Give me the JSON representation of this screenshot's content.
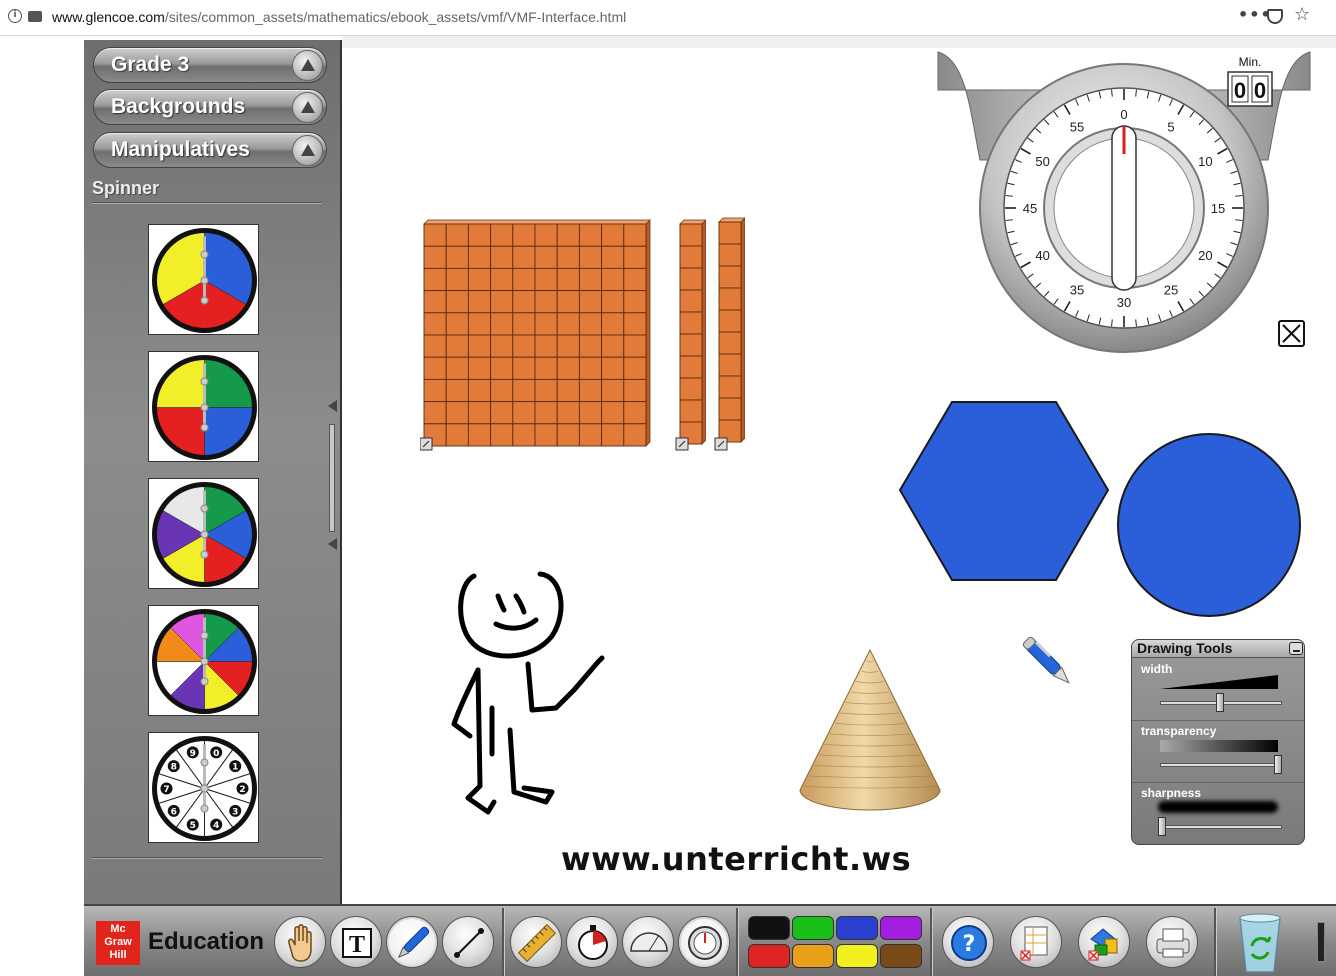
{
  "browser": {
    "url_domain": "www.glencoe.com",
    "url_path": "/sites/common_assets/mathematics/ebook_assets/vmf/VMF-Interface.html",
    "more_label": "•••"
  },
  "sidebar": {
    "menus": [
      {
        "label": "Grade 3"
      },
      {
        "label": "Backgrounds"
      },
      {
        "label": "Manipulatives"
      }
    ],
    "section_title": "Spinner",
    "spinners": [
      {
        "name": "3-color",
        "colors": [
          "#2b5fd9",
          "#e52020",
          "#f2ee2a"
        ]
      },
      {
        "name": "4-color",
        "colors": [
          "#149a4a",
          "#2b5fd9",
          "#e52020",
          "#f2ee2a"
        ]
      },
      {
        "name": "6-color",
        "colors": [
          "#149a4a",
          "#2b5fd9",
          "#e52020",
          "#f2ee2a",
          "#6a35b5",
          "#e8e8e8"
        ]
      },
      {
        "name": "8-color",
        "colors": [
          "#149a4a",
          "#2b5fd9",
          "#e52020",
          "#f2ee2a",
          "#6a35b5",
          "#ffffff",
          "#f28a1a",
          "#e055e0"
        ]
      },
      {
        "name": "numbers",
        "numbers": [
          "0",
          "1",
          "2",
          "3",
          "4",
          "5",
          "6",
          "7",
          "8",
          "9"
        ]
      }
    ]
  },
  "timer": {
    "min_label": "Min.",
    "digits": [
      "0",
      "0"
    ],
    "dial_numbers": [
      "0",
      "5",
      "10",
      "15",
      "20",
      "25",
      "30",
      "35",
      "40",
      "45",
      "50",
      "55"
    ]
  },
  "watermark": "www.unterricht.ws",
  "drawing_tools": {
    "title": "Drawing Tools",
    "rows": [
      {
        "label": "width",
        "knob": 0.5
      },
      {
        "label": "transparency",
        "knob": 1.0
      },
      {
        "label": "sharpness",
        "knob": 0.0
      }
    ]
  },
  "toolbar": {
    "logo_lines": [
      "Mc",
      "Graw",
      "Hill"
    ],
    "logo_text": "Education",
    "text_tool_glyph": "T",
    "help_glyph": "?",
    "colors": [
      "#111111",
      "#19c019",
      "#2b3fd0",
      "#a31ee0",
      "#e02424",
      "#e8a018",
      "#f0f01e",
      "#7a4a18"
    ]
  },
  "colors": {
    "base_ten_orange": "#e27a3a",
    "shape_blue": "#2b5fd9"
  }
}
